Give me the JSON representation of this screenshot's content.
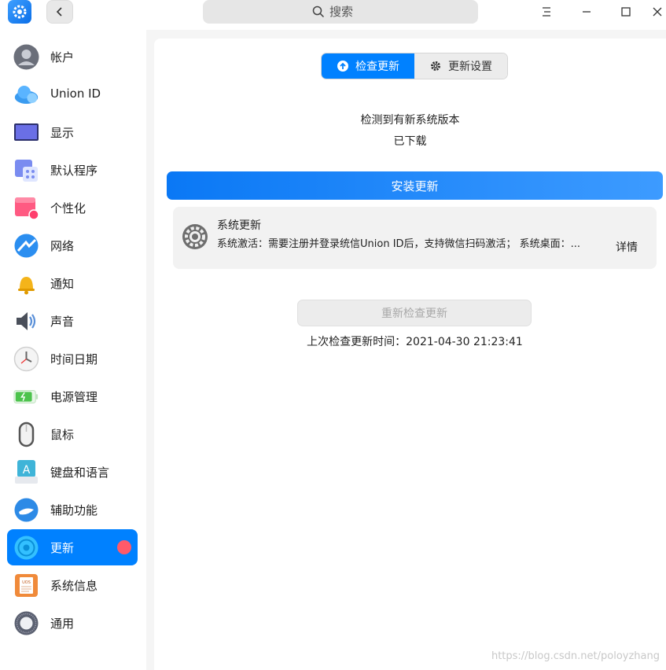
{
  "titlebar": {
    "search_placeholder": "搜索"
  },
  "sidebar": {
    "items": [
      {
        "label": "帐户",
        "icon": "account-icon",
        "color": "#6b6f7a"
      },
      {
        "label": "Union ID",
        "icon": "cloud-icon",
        "color": "#3a9bf0"
      },
      {
        "label": "显示",
        "icon": "display-icon",
        "color": "#6a6fe6"
      },
      {
        "label": "默认程序",
        "icon": "default-apps-icon",
        "color": "#7a8cf0"
      },
      {
        "label": "个性化",
        "icon": "personalization-icon",
        "color": "#ff5a82"
      },
      {
        "label": "网络",
        "icon": "network-icon",
        "color": "#2b8ef0"
      },
      {
        "label": "通知",
        "icon": "bell-icon",
        "color": "#f4b41a"
      },
      {
        "label": "声音",
        "icon": "speaker-icon",
        "color": "#5a90d8"
      },
      {
        "label": "时间日期",
        "icon": "clock-icon",
        "color": "#666666"
      },
      {
        "label": "电源管理",
        "icon": "battery-icon",
        "color": "#4cc34c"
      },
      {
        "label": "鼠标",
        "icon": "mouse-icon",
        "color": "#555555"
      },
      {
        "label": "键盘和语言",
        "icon": "keyboard-icon",
        "color": "#3fb4d8"
      },
      {
        "label": "辅助功能",
        "icon": "accessibility-icon",
        "color": "#2d8ae6"
      },
      {
        "label": "更新",
        "icon": "update-icon",
        "color": "#33c0ff",
        "active": true
      },
      {
        "label": "系统信息",
        "icon": "system-info-icon",
        "color": "#f08a3a"
      },
      {
        "label": "通用",
        "icon": "general-icon",
        "color": "#5a6070"
      }
    ]
  },
  "main": {
    "tabs": [
      {
        "label": "检查更新",
        "icon": "upload-circle-icon"
      },
      {
        "label": "更新设置",
        "icon": "gear-icon"
      }
    ],
    "status_line1": "检测到有新系统版本",
    "status_line2": "已下载",
    "install_label": "安装更新",
    "card": {
      "title": "系统更新",
      "description": "系统激活：需要注册并登录统信Union ID后，支持微信扫码激活； 系统桌面：...",
      "detail_label": "详情"
    },
    "recheck_label": "重新检查更新",
    "last_check": "上次检查更新时间：2021-04-30 21:23:41"
  },
  "watermark": "https://blog.csdn.net/poloyzhang",
  "colors": {
    "accent": "#0081ff",
    "badge": "#ff5a6a"
  }
}
